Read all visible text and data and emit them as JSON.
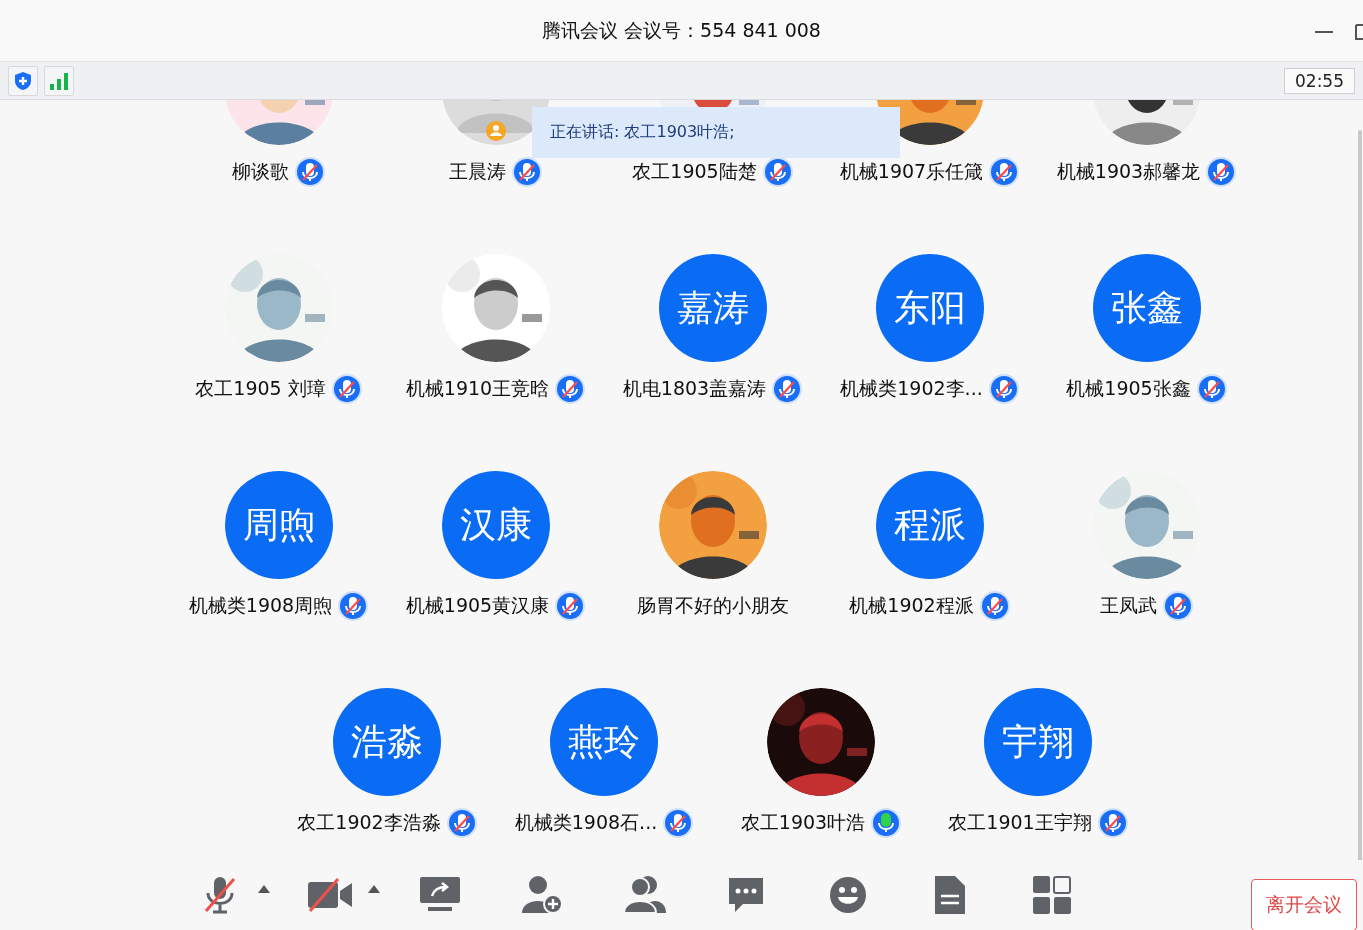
{
  "window": {
    "title": "腾讯会议 会议号：554 841 008"
  },
  "timer": "02:55",
  "speaking": "正在讲话: 农工1903叶浩;",
  "participants": [
    {
      "name": "柳谈歌",
      "muted": true
    },
    {
      "name": "王晨涛",
      "avatar": {
        "kind": "default"
      },
      "muted": true
    },
    {
      "name": "农工1905陆楚",
      "muted": true
    },
    {
      "name": "机械1907乐任箴",
      "muted": true
    },
    {
      "name": "机械1903郝馨龙",
      "muted": true
    },
    {
      "name": "农工1905 刘璋",
      "muted": true
    },
    {
      "name": "机械1910王竞晗",
      "muted": true
    },
    {
      "name": "机电1803盖嘉涛",
      "avatar": {
        "kind": "initials",
        "text": "嘉涛"
      },
      "muted": true
    },
    {
      "name": "机械类1902李...",
      "avatar": {
        "kind": "initials",
        "text": "东阳"
      },
      "muted": true
    },
    {
      "name": "机械1905张鑫",
      "avatar": {
        "kind": "initials",
        "text": "张鑫"
      },
      "muted": true
    },
    {
      "name": "机械类1908周煦",
      "avatar": {
        "kind": "initials",
        "text": "周煦"
      },
      "muted": true
    },
    {
      "name": "机械1905黄汉康",
      "avatar": {
        "kind": "initials",
        "text": "汉康"
      },
      "muted": true
    },
    {
      "name": "肠胃不好的小朋友"
    },
    {
      "name": "机械1902程派",
      "avatar": {
        "kind": "initials",
        "text": "程派"
      },
      "muted": true
    },
    {
      "name": "王凤武",
      "muted": true
    },
    {
      "name": "农工1902李浩淼",
      "avatar": {
        "kind": "initials",
        "text": "浩淼"
      },
      "muted": true
    },
    {
      "name": "机械类1908石...",
      "avatar": {
        "kind": "initials",
        "text": "燕玲"
      },
      "muted": true
    },
    {
      "name": "农工1903叶浩",
      "muted": false
    },
    {
      "name": "农工1901王宇翔",
      "avatar": {
        "kind": "initials",
        "text": "宇翔"
      },
      "muted": true
    }
  ],
  "toolbar": {
    "mic_muted": true,
    "video_off": true
  },
  "leave_button": "离开会议"
}
